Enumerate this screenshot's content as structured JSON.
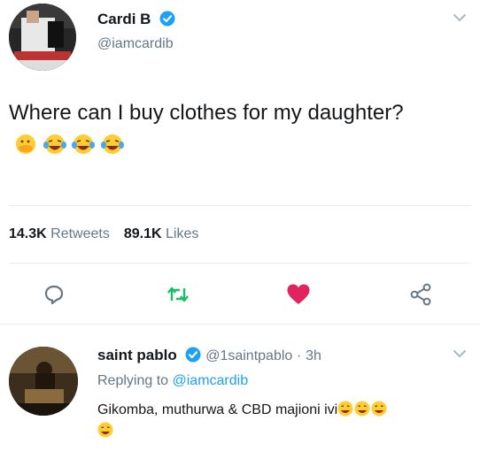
{
  "tweet": {
    "display_name": "Cardi B",
    "handle": "@iamcardib",
    "text": "Where can I buy clothes for my daughter?",
    "emojis": [
      "face-with-hand-over-mouth-emoji",
      "laughing-crying-emoji",
      "laughing-crying-emoji",
      "laughing-crying-emoji"
    ]
  },
  "stats": {
    "retweets_count": "14.3K",
    "retweets_label": "Retweets",
    "likes_count": "89.1K",
    "likes_label": "Likes"
  },
  "actions": {
    "reply_icon": "reply-bubble-icon",
    "retweet_icon": "retweet-icon",
    "like_icon": "heart-icon",
    "share_icon": "share-icon",
    "like_color": "#e0245e",
    "accent_color": "#1da1f2"
  },
  "reply": {
    "display_name": "saint pablo",
    "handle": "@1saintpablo",
    "separator": "·",
    "time": "3h",
    "replying_prefix": "Replying to",
    "replying_to": "@iamcardib",
    "text": "Gikomba, muthurwa & CBD majioni ivi"
  }
}
